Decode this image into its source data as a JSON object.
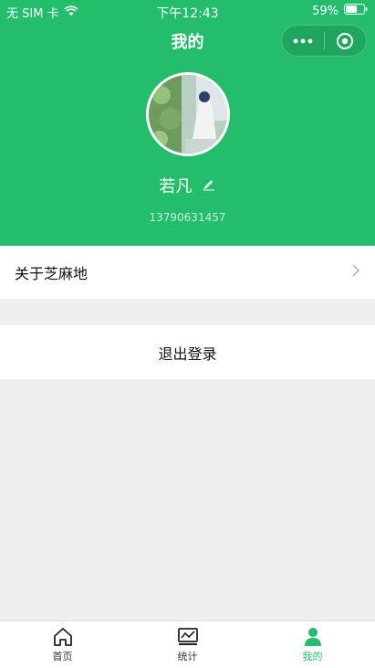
{
  "status_bar": {
    "carrier": "无 SIM 卡",
    "time": "下午12:43",
    "battery": "59%"
  },
  "nav": {
    "title": "我的"
  },
  "profile": {
    "name": "若凡",
    "phone": "13790631457"
  },
  "menu": {
    "about_label": "关于芝麻地",
    "logout_label": "退出登录"
  },
  "tabbar": {
    "items": [
      {
        "label": "首页",
        "icon": "home-icon"
      },
      {
        "label": "统计",
        "icon": "chart-icon"
      },
      {
        "label": "我的",
        "icon": "user-icon"
      }
    ],
    "active_index": 2
  },
  "colors": {
    "brand_green": "#23bd6b",
    "background": "#efefef"
  }
}
